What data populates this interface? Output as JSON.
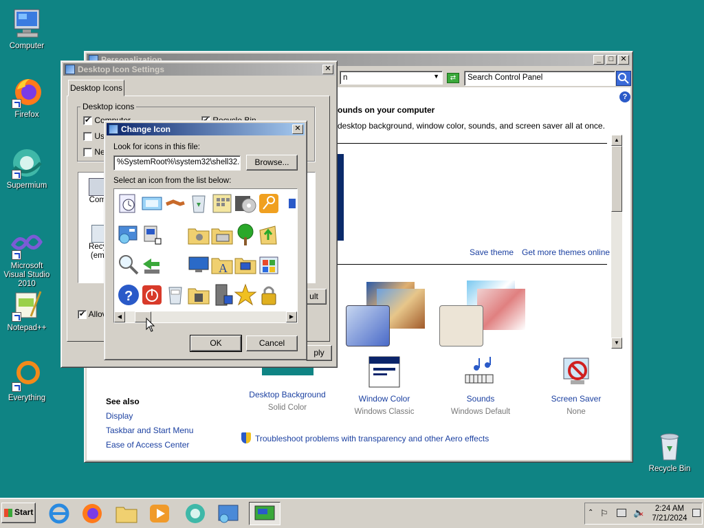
{
  "desktop": {
    "icons": [
      {
        "label": "Computer"
      },
      {
        "label": "Firefox"
      },
      {
        "label": "Supermium"
      },
      {
        "label": "Microsoft Visual Studio 2010"
      },
      {
        "label": "Notepad++"
      },
      {
        "label": "Everything"
      },
      {
        "label": "Recycle Bin"
      }
    ]
  },
  "personalization": {
    "title": "Personalization",
    "address_tail": "n",
    "search_placeholder": "Search Control Panel",
    "heading": "ounds on your computer",
    "subheading": "desktop background, window color, sounds, and screen saver all at once.",
    "save_theme": "Save theme",
    "more_themes": "Get more themes online",
    "see_also": "See also",
    "links": [
      "Display",
      "Taskbar and Start Menu",
      "Ease of Access Center"
    ],
    "troubleshoot": "Troubleshoot problems with transparency and other Aero effects",
    "categories": [
      {
        "name": "Desktop Background",
        "value": "Solid Color"
      },
      {
        "name": "Window Color",
        "value": "Windows Classic"
      },
      {
        "name": "Sounds",
        "value": "Windows Default"
      },
      {
        "name": "Screen Saver",
        "value": "None"
      }
    ]
  },
  "desktop_icon_settings": {
    "title": "Desktop Icon Settings",
    "tab": "Desktop Icons",
    "group": "Desktop icons",
    "checks": [
      {
        "label": "Computer",
        "checked": true
      },
      {
        "label": "Us",
        "checked": false
      },
      {
        "label": "Ne",
        "checked": false
      },
      {
        "label": "Recycle Bin",
        "checked": true
      }
    ],
    "preview": [
      "Comp",
      "Recyc",
      "(emp"
    ],
    "allow_label": "Allov",
    "restore_default_tail": "ult",
    "apply_tail": "ply"
  },
  "change_icon": {
    "title": "Change Icon",
    "look_label": "Look for icons in this file:",
    "file_path": "%SystemRoot%\\system32\\shell32.dll",
    "browse": "Browse...",
    "select_label": "Select an icon from the list below:",
    "ok": "OK",
    "cancel": "Cancel"
  },
  "taskbar": {
    "start": "Start",
    "time": "2:24 AM",
    "date": "7/21/2024"
  },
  "colors": {
    "desktop": "#0f8484",
    "face": "#d4d0c8",
    "active_title_start": "#0a246a",
    "active_title_end": "#a6caf0",
    "link": "#1a3fa0"
  }
}
